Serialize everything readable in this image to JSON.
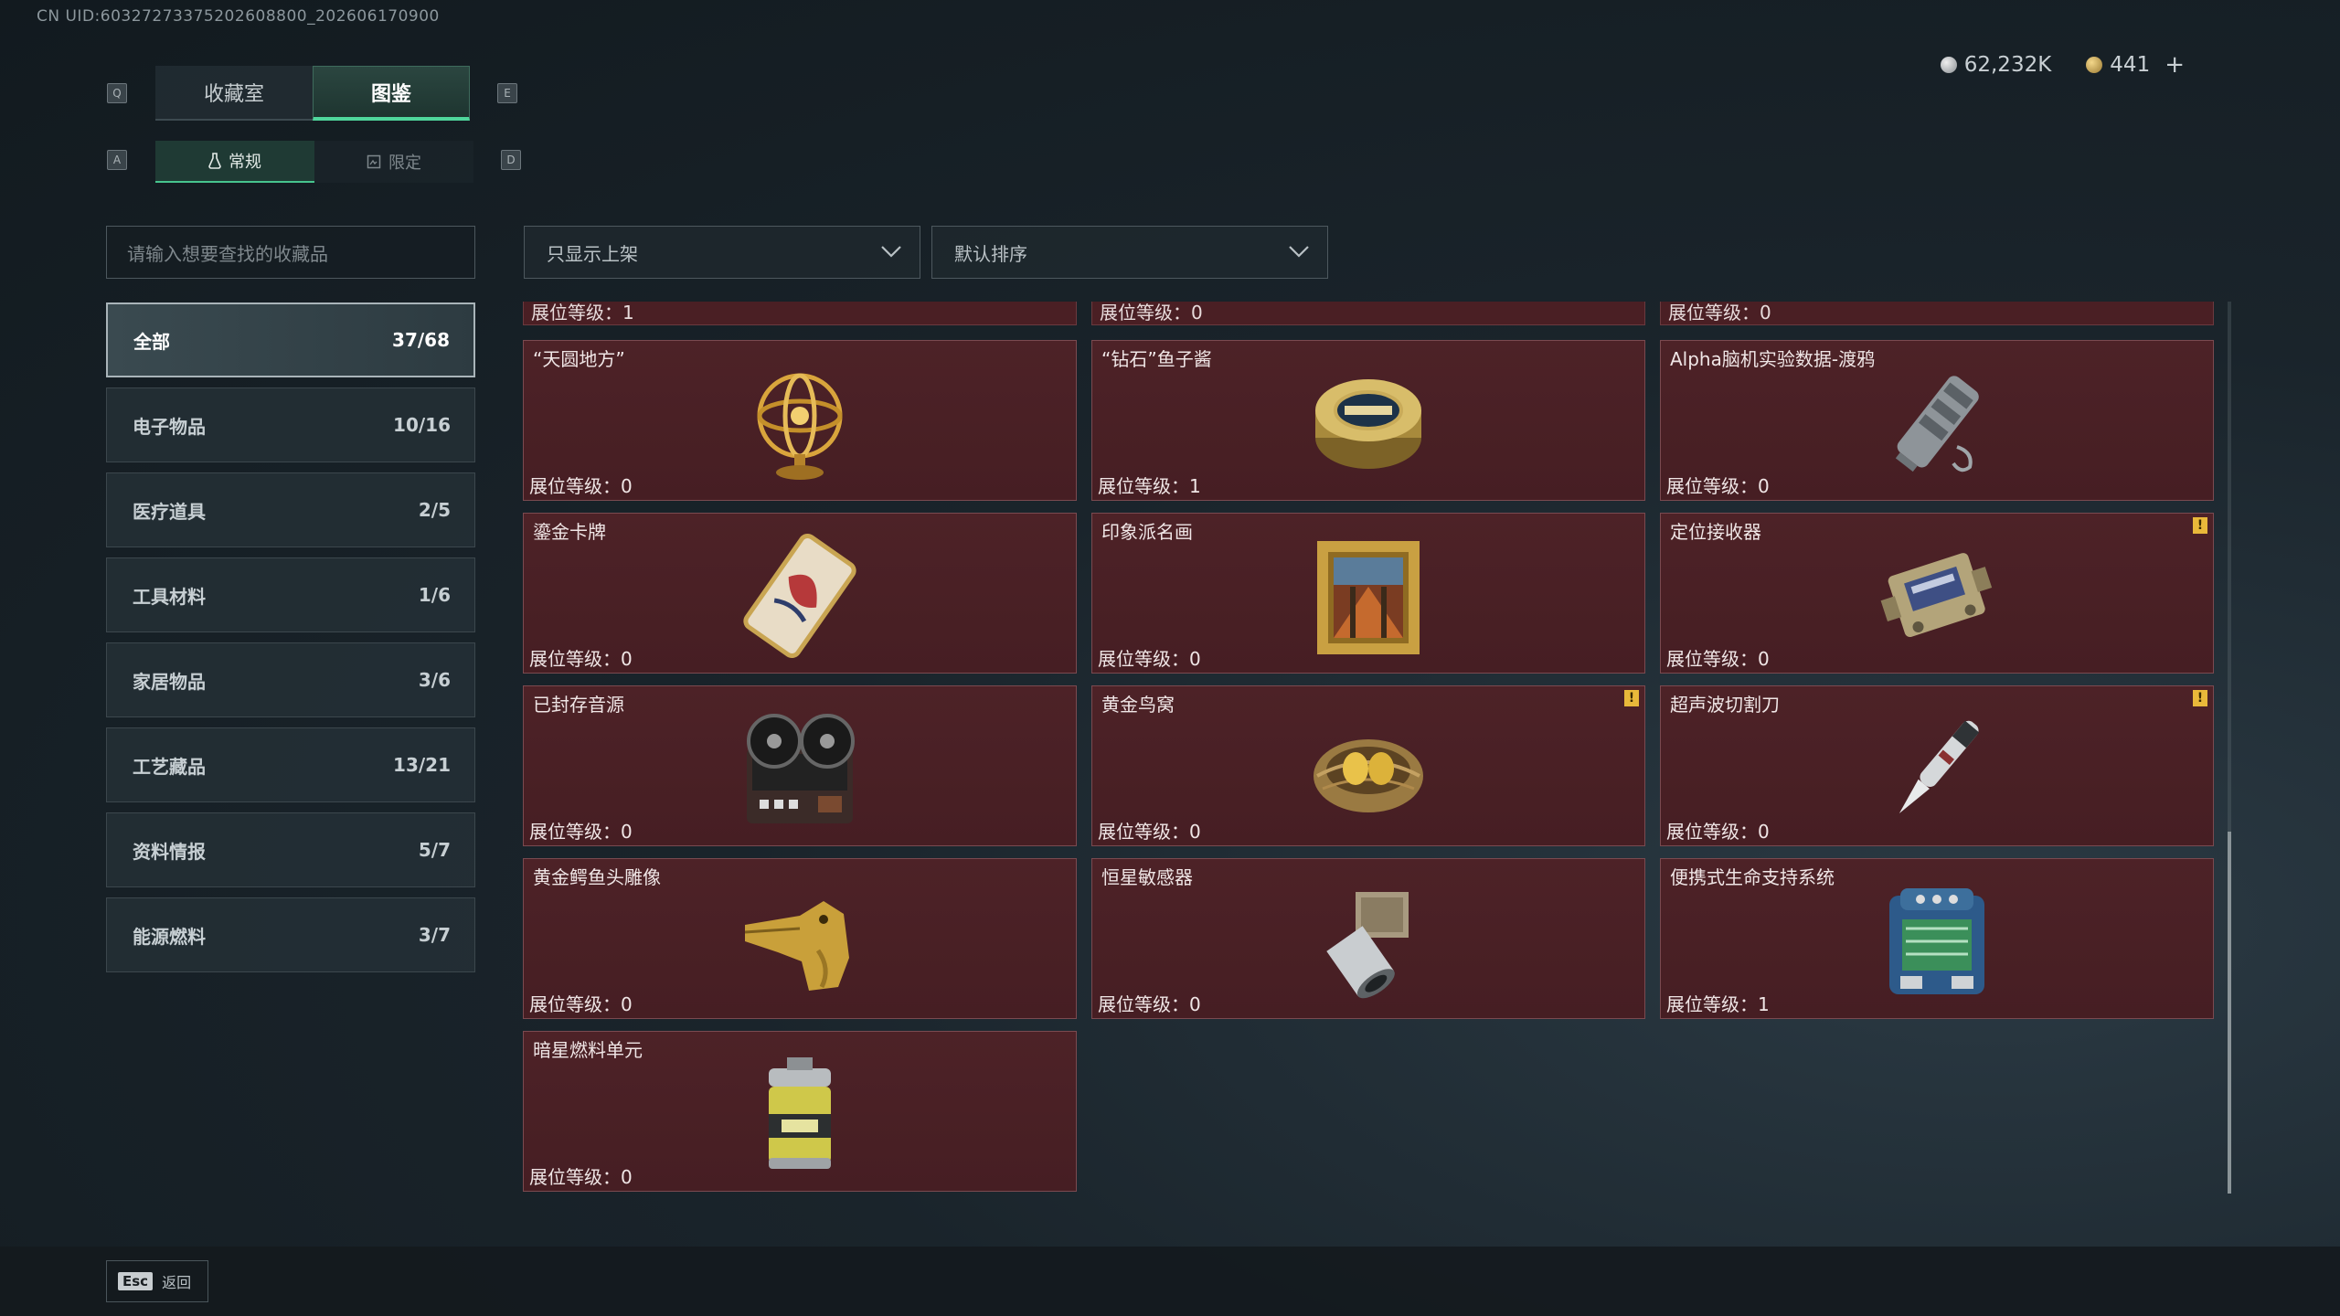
{
  "header": {
    "uid": "CN UID:60327273375202608800_202606170900",
    "currency": [
      {
        "icon": "silver-coin-icon",
        "value": "62,232K"
      },
      {
        "icon": "gold-coin-icon",
        "value": "441"
      }
    ],
    "plus": "+"
  },
  "keys": {
    "prev_tab": "Q",
    "next_tab": "E",
    "prev_sub": "A",
    "next_sub": "D"
  },
  "tabs": [
    {
      "label": "收藏室",
      "active": false
    },
    {
      "label": "图鉴",
      "active": true
    }
  ],
  "subtabs": [
    {
      "label": "常规",
      "active": true
    },
    {
      "label": "限定",
      "active": false
    }
  ],
  "search": {
    "placeholder": "请输入想要查找的收藏品"
  },
  "filters": {
    "shelf": "只显示上架",
    "sort": "默认排序"
  },
  "categories": [
    {
      "label": "全部",
      "count": "37/68",
      "active": true
    },
    {
      "label": "电子物品",
      "count": "10/16"
    },
    {
      "label": "医疗道具",
      "count": "2/5"
    },
    {
      "label": "工具材料",
      "count": "1/6"
    },
    {
      "label": "家居物品",
      "count": "3/6"
    },
    {
      "label": "工艺藏品",
      "count": "13/21"
    },
    {
      "label": "资料情报",
      "count": "5/7"
    },
    {
      "label": "能源燃料",
      "count": "3/7"
    }
  ],
  "top_strips": [
    "展位等级：1",
    "展位等级：0",
    "展位等级：0"
  ],
  "items": [
    {
      "name": "“天圆地方”",
      "level": "展位等级：0",
      "icon": "armillary-sphere-icon",
      "warn": false
    },
    {
      "name": "“钻石”鱼子酱",
      "level": "展位等级：1",
      "icon": "caviar-tin-icon",
      "warn": false
    },
    {
      "name": "Alpha脑机实验数据-渡鸦",
      "level": "展位等级：0",
      "icon": "data-drive-icon",
      "warn": false
    },
    {
      "name": "鎏金卡牌",
      "level": "展位等级：0",
      "icon": "gold-card-icon",
      "warn": false
    },
    {
      "name": "印象派名画",
      "level": "展位等级：0",
      "icon": "painting-icon",
      "warn": false
    },
    {
      "name": "定位接收器",
      "level": "展位等级：0",
      "icon": "receiver-icon",
      "warn": true
    },
    {
      "name": "已封存音源",
      "level": "展位等级：0",
      "icon": "reel-recorder-icon",
      "warn": false
    },
    {
      "name": "黄金鸟窝",
      "level": "展位等级：0",
      "icon": "golden-nest-icon",
      "warn": true
    },
    {
      "name": "超声波切割刀",
      "level": "展位等级：0",
      "icon": "ultrasonic-knife-icon",
      "warn": true
    },
    {
      "name": "黄金鳄鱼头雕像",
      "level": "展位等级：0",
      "icon": "crocodile-statue-icon",
      "warn": false
    },
    {
      "name": "恒星敏感器",
      "level": "展位等级：0",
      "icon": "star-sensor-icon",
      "warn": false
    },
    {
      "name": "便携式生命支持系统",
      "level": "展位等级：1",
      "icon": "life-support-icon",
      "warn": false
    },
    {
      "name": "暗星燃料单元",
      "level": "展位等级：0",
      "icon": "fuel-canister-icon",
      "warn": false
    }
  ],
  "warn_mark": "!",
  "footer": {
    "esc_key": "Esc",
    "back_label": "返回"
  }
}
